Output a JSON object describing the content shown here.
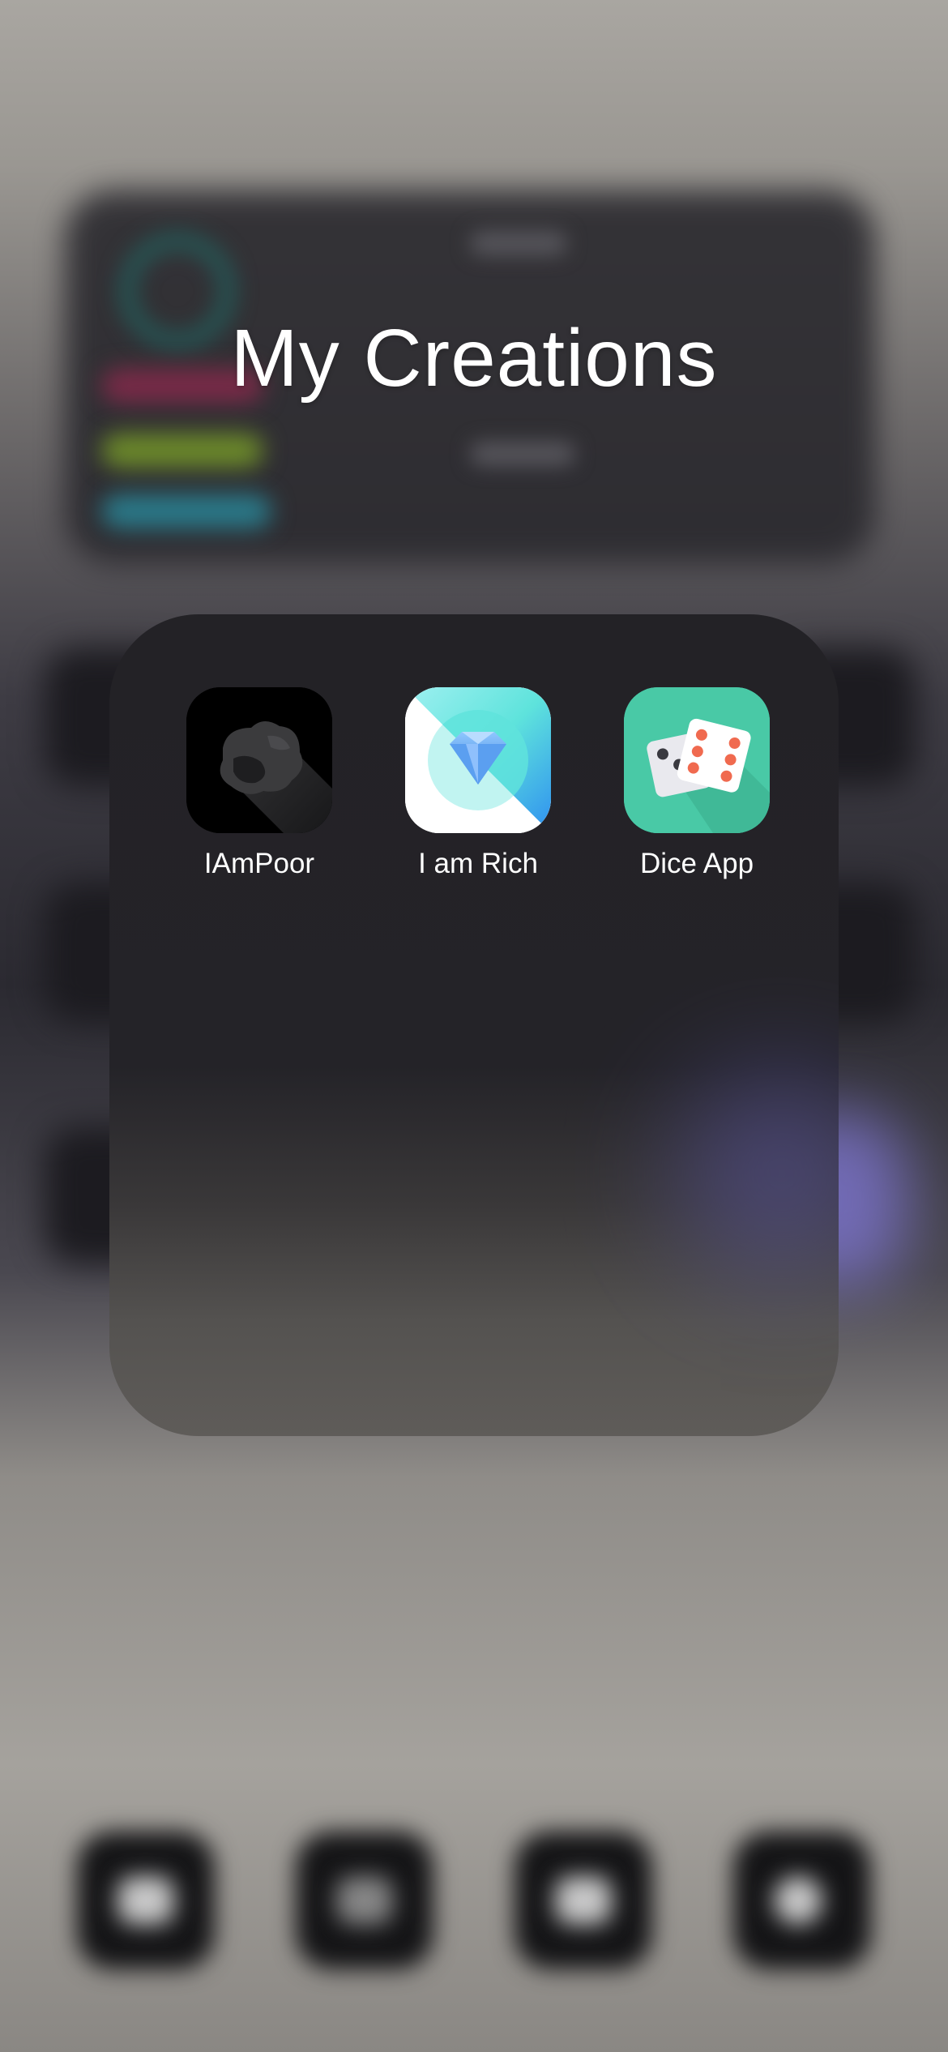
{
  "folder": {
    "title": "My Creations"
  },
  "apps": [
    {
      "label": "IAmPoor",
      "icon": "coal-icon"
    },
    {
      "label": "I am Rich",
      "icon": "diamond-icon"
    },
    {
      "label": "Dice App",
      "icon": "dice-icon"
    }
  ],
  "colors": {
    "folder_bg": "#232226",
    "label_text": "#ffffff",
    "dice_bg": "#49c9a6",
    "rich_gradient_start": "#5ee3dc",
    "rich_gradient_end": "#2f8ff0"
  }
}
